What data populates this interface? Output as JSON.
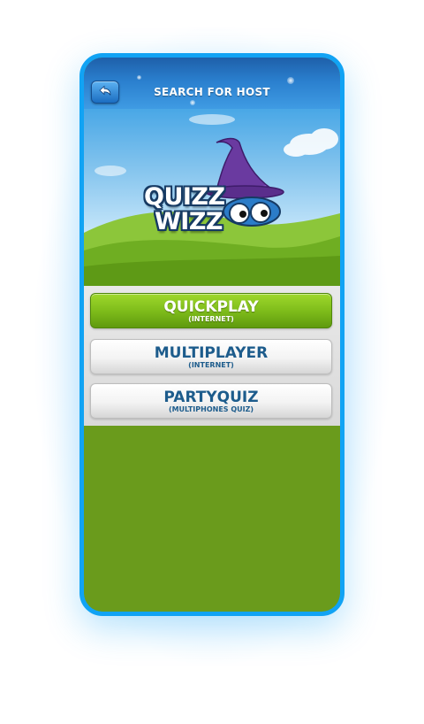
{
  "header": {
    "title": "SEARCH FOR HOST",
    "back_icon": "back-arrow-icon"
  },
  "logo": {
    "line1": "QUIZZ",
    "line2": "WIZZ"
  },
  "menu": {
    "quickplay": {
      "label": "QUICKPLAY",
      "sublabel": "(INTERNET)"
    },
    "multiplayer": {
      "label": "MULTIPLAYER",
      "sublabel": "(INTERNET)"
    },
    "partyquiz": {
      "label": "PARTYQUIZ",
      "sublabel": "(MULTIPHONES QUIZ)"
    }
  },
  "colors": {
    "device_frame": "#11a3f4",
    "title_bar": "#2a7fce",
    "primary_button": "#7fbd1b",
    "secondary_button_text": "#1d5c8c",
    "background_green": "#6a9b1c"
  }
}
